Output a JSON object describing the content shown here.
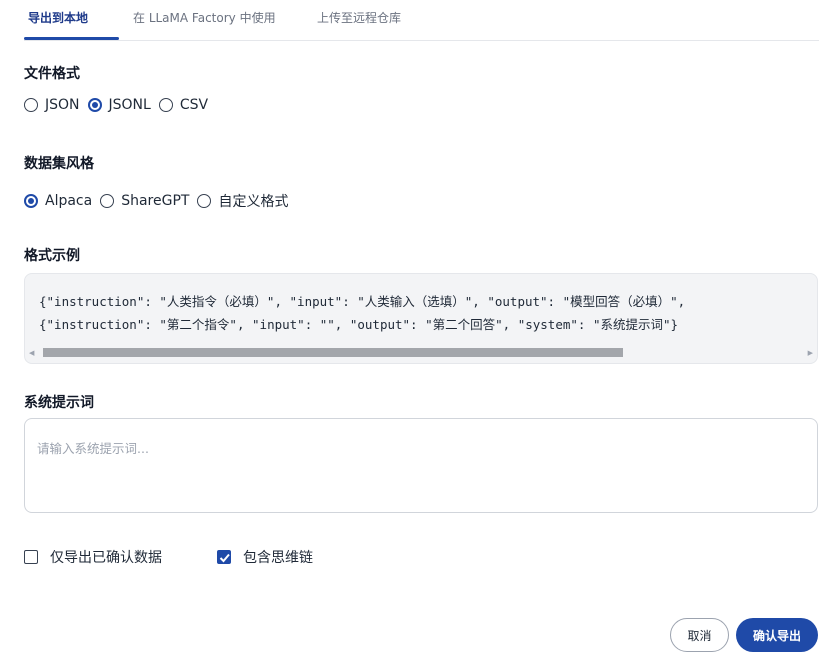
{
  "tabs": [
    {
      "label": "导出到本地"
    },
    {
      "label": "在 LLaMA Factory 中使用"
    },
    {
      "label": "上传至远程仓库"
    }
  ],
  "file_format": {
    "title": "文件格式",
    "options": [
      "JSON",
      "JSONL",
      "CSV"
    ],
    "selected": "JSONL"
  },
  "dataset_style": {
    "title": "数据集风格",
    "options": [
      "Alpaca",
      "ShareGPT",
      "自定义格式"
    ],
    "selected": "Alpaca"
  },
  "example": {
    "title": "格式示例",
    "lines": [
      "{\"instruction\": \"人类指令（必填）\", \"input\": \"人类输入（选填）\", \"output\": \"模型回答（必填）\",",
      "{\"instruction\": \"第二个指令\", \"input\": \"\", \"output\": \"第二个回答\", \"system\": \"系统提示词\"}"
    ]
  },
  "system_prompt": {
    "title": "系统提示词",
    "placeholder": "请输入系统提示词..."
  },
  "checkboxes": {
    "confirmed_only": {
      "label": "仅导出已确认数据",
      "checked": false
    },
    "include_cot": {
      "label": "包含思维链",
      "checked": true
    }
  },
  "buttons": {
    "cancel": "取消",
    "confirm": "确认导出"
  },
  "colors": {
    "accent": "#1f4aa8"
  }
}
